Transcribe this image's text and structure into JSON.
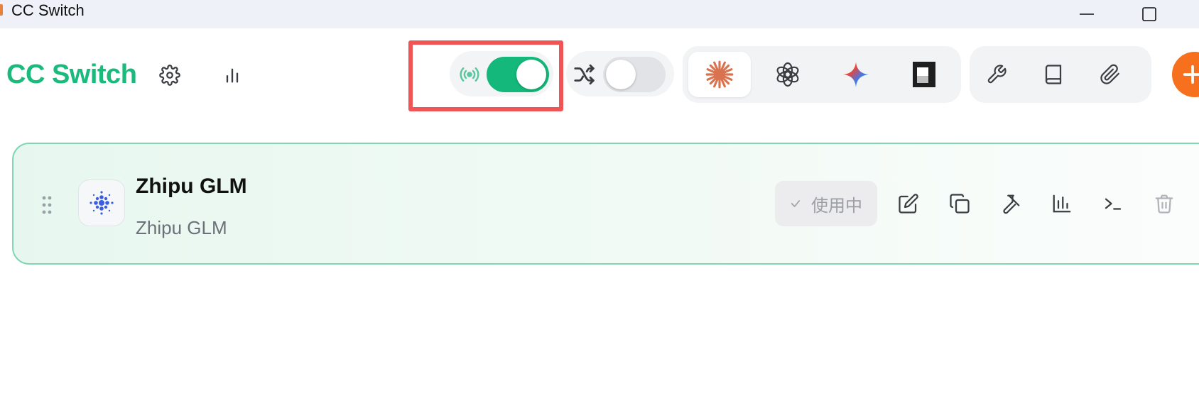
{
  "window": {
    "title": "CC Switch"
  },
  "header": {
    "brand": "CC Switch",
    "settings_icon": "gear-icon",
    "stats_icon": "bar-chart-icon"
  },
  "proxy": {
    "icon": "radio-broadcast-icon",
    "enabled": true,
    "accent": "#13b87a",
    "highlight_color": "#f05455"
  },
  "failover": {
    "icon": "shuffle-icon",
    "enabled": false
  },
  "apps": [
    {
      "name": "claude-icon",
      "active": true
    },
    {
      "name": "openai-icon",
      "active": false
    },
    {
      "name": "gemini-icon",
      "active": false
    },
    {
      "name": "terminal-app-icon",
      "active": false
    }
  ],
  "tools": [
    {
      "name": "wrench-icon"
    },
    {
      "name": "book-icon"
    },
    {
      "name": "paperclip-icon"
    }
  ],
  "add_button": {
    "icon": "plus-icon",
    "color": "#f6701e"
  },
  "provider": {
    "name": "Zhipu GLM",
    "subtitle": "Zhipu GLM",
    "status_label": "使用中",
    "status_icon": "check-icon",
    "actions": [
      "edit-icon",
      "copy-icon",
      "test-icon",
      "usage-chart-icon",
      "terminal-icon",
      "trash-icon"
    ]
  }
}
